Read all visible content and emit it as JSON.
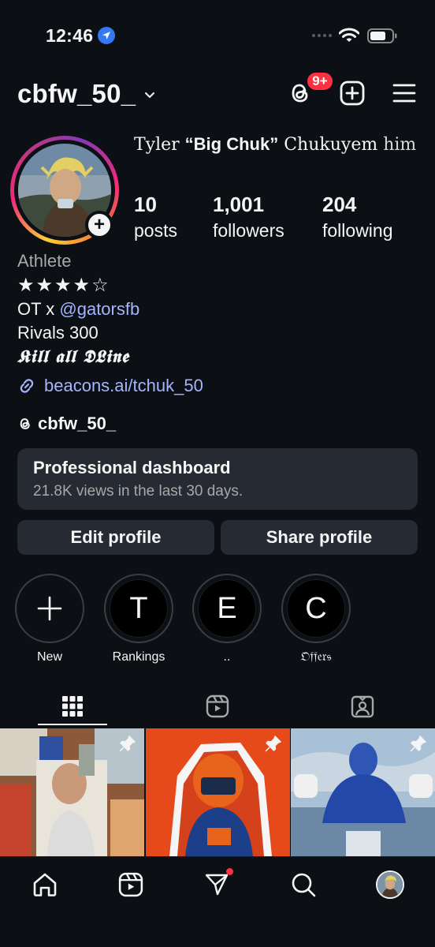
{
  "status_bar": {
    "time": "12:46"
  },
  "header": {
    "username": "cbfw_50_",
    "notification_badge": "9+"
  },
  "profile": {
    "full_name_prefix": "Tyler ",
    "full_name_nick": "“Big Chuk”",
    "full_name_suffix": " Chukuyem ",
    "pronouns": "him",
    "stats": {
      "posts_count": "10",
      "posts_label": "posts",
      "followers_count": "1,001",
      "followers_label": "followers",
      "following_count": "204",
      "following_label": "following"
    },
    "category": "Athlete",
    "bio_stars": "★★★★☆",
    "bio_line_prefix": "OT x ",
    "bio_mention": "@gatorsfb",
    "bio_line2": "Rivals 300",
    "bio_line3": "𝕶𝖎𝖑𝖑 𝖆𝖑𝖑 𝕯𝕷𝖎𝖓𝖊",
    "link": "beacons.ai/tchuk_50",
    "threads_handle": "cbfw_50_"
  },
  "dashboard": {
    "title": "Professional dashboard",
    "subtitle": "21.8K views in the last 30 days."
  },
  "buttons": {
    "edit": "Edit profile",
    "share": "Share profile"
  },
  "highlights": [
    {
      "letter": "+",
      "label": "New"
    },
    {
      "letter": "T",
      "label": "Rankings"
    },
    {
      "letter": "E",
      "label": ".."
    },
    {
      "letter": "C",
      "label": "𝔒𝔣𝔣𝔢𝔯𝔰"
    }
  ],
  "colors": {
    "accent_link": "#a4b4ff",
    "badge": "#ff3040",
    "surface": "#262a33",
    "background": "#0c1014"
  },
  "icons": {
    "header": [
      "threads-icon",
      "create-icon",
      "menu-icon"
    ],
    "tabs": [
      "grid-icon",
      "reels-icon",
      "tagged-icon"
    ],
    "nav": [
      "home-icon",
      "reels-icon",
      "direct-icon",
      "search-icon",
      "profile-avatar"
    ]
  }
}
